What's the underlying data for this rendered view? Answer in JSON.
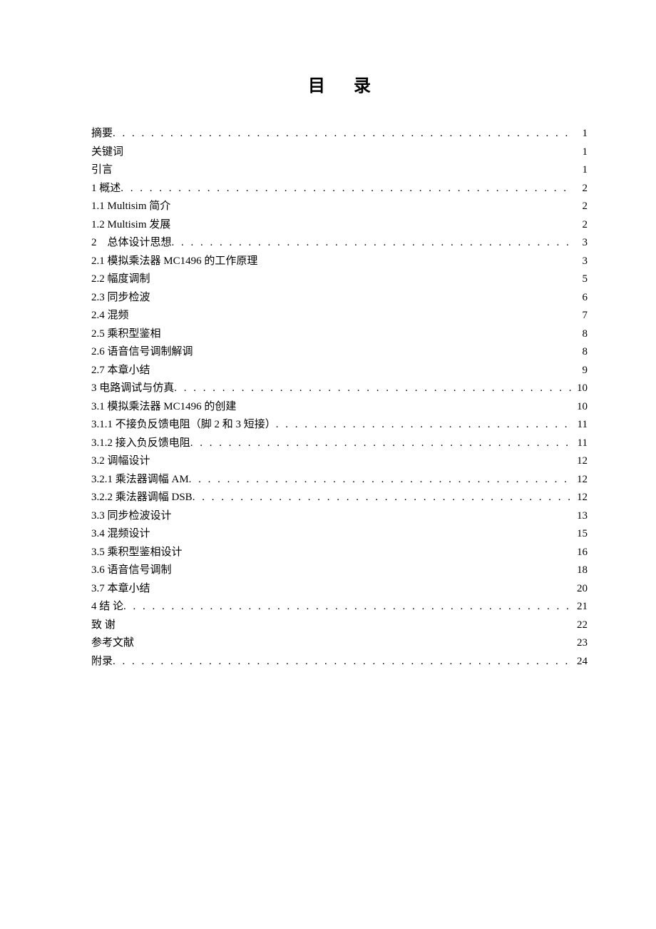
{
  "title": "目录",
  "toc": [
    {
      "label": "摘要",
      "page": "1",
      "dots": true
    },
    {
      "label": "关键词",
      "page": "1",
      "dots": false
    },
    {
      "label": "引言",
      "page": "1",
      "dots": false
    },
    {
      "label": "1 概述",
      "page": "2",
      "dots": true
    },
    {
      "label": "1.1 Multisim 简介",
      "page": "2",
      "dots": false
    },
    {
      "label": "1.2 Multisim 发展",
      "page": "2",
      "dots": false
    },
    {
      "label": "2 总体设计思想",
      "page": "3",
      "dots": true
    },
    {
      "label": "2.1 模拟乘法器 MC1496 的工作原理",
      "page": "3",
      "dots": false
    },
    {
      "label": "2.2 幅度调制",
      "page": "5",
      "dots": false
    },
    {
      "label": "2.3 同步检波",
      "page": "6",
      "dots": false
    },
    {
      "label": "2.4 混频",
      "page": "7",
      "dots": false
    },
    {
      "label": "2.5 乘积型鉴相",
      "page": "8",
      "dots": false
    },
    {
      "label": "2.6 语音信号调制解调",
      "page": "8",
      "dots": false
    },
    {
      "label": "2.7 本章小结",
      "page": "9",
      "dots": false
    },
    {
      "label": "3 电路调试与仿真",
      "page": "10",
      "dots": true
    },
    {
      "label": "3.1 模拟乘法器 MC1496 的创建",
      "page": "10",
      "dots": false
    },
    {
      "label": "3.1.1 不接负反馈电阻（脚 2 和 3 短接）",
      "page": "11",
      "dots": true
    },
    {
      "label": "3.1.2 接入负反馈电阻",
      "page": "11",
      "dots": true
    },
    {
      "label": "3.2 调幅设计",
      "page": "12",
      "dots": false
    },
    {
      "label": "3.2.1 乘法器调幅 AM ",
      "page": "12",
      "dots": true
    },
    {
      "label": "3.2.2 乘法器调幅 DSB ",
      "page": "12",
      "dots": true
    },
    {
      "label": "3.3 同步检波设计",
      "page": "13",
      "dots": false
    },
    {
      "label": "3.4 混频设计",
      "page": "15",
      "dots": false
    },
    {
      "label": "3.5 乘积型鉴相设计",
      "page": "16",
      "dots": false
    },
    {
      "label": "3.6 语音信号调制",
      "page": "18",
      "dots": false
    },
    {
      "label": "3.7 本章小结",
      "page": "20",
      "dots": false
    },
    {
      "label": "4 结 论",
      "page": "21",
      "dots": true
    },
    {
      "label": "致 谢",
      "page": "22",
      "dots": false
    },
    {
      "label": "参考文献",
      "page": "23",
      "dots": false
    },
    {
      "label": "附录",
      "page": "24",
      "dots": true
    }
  ]
}
